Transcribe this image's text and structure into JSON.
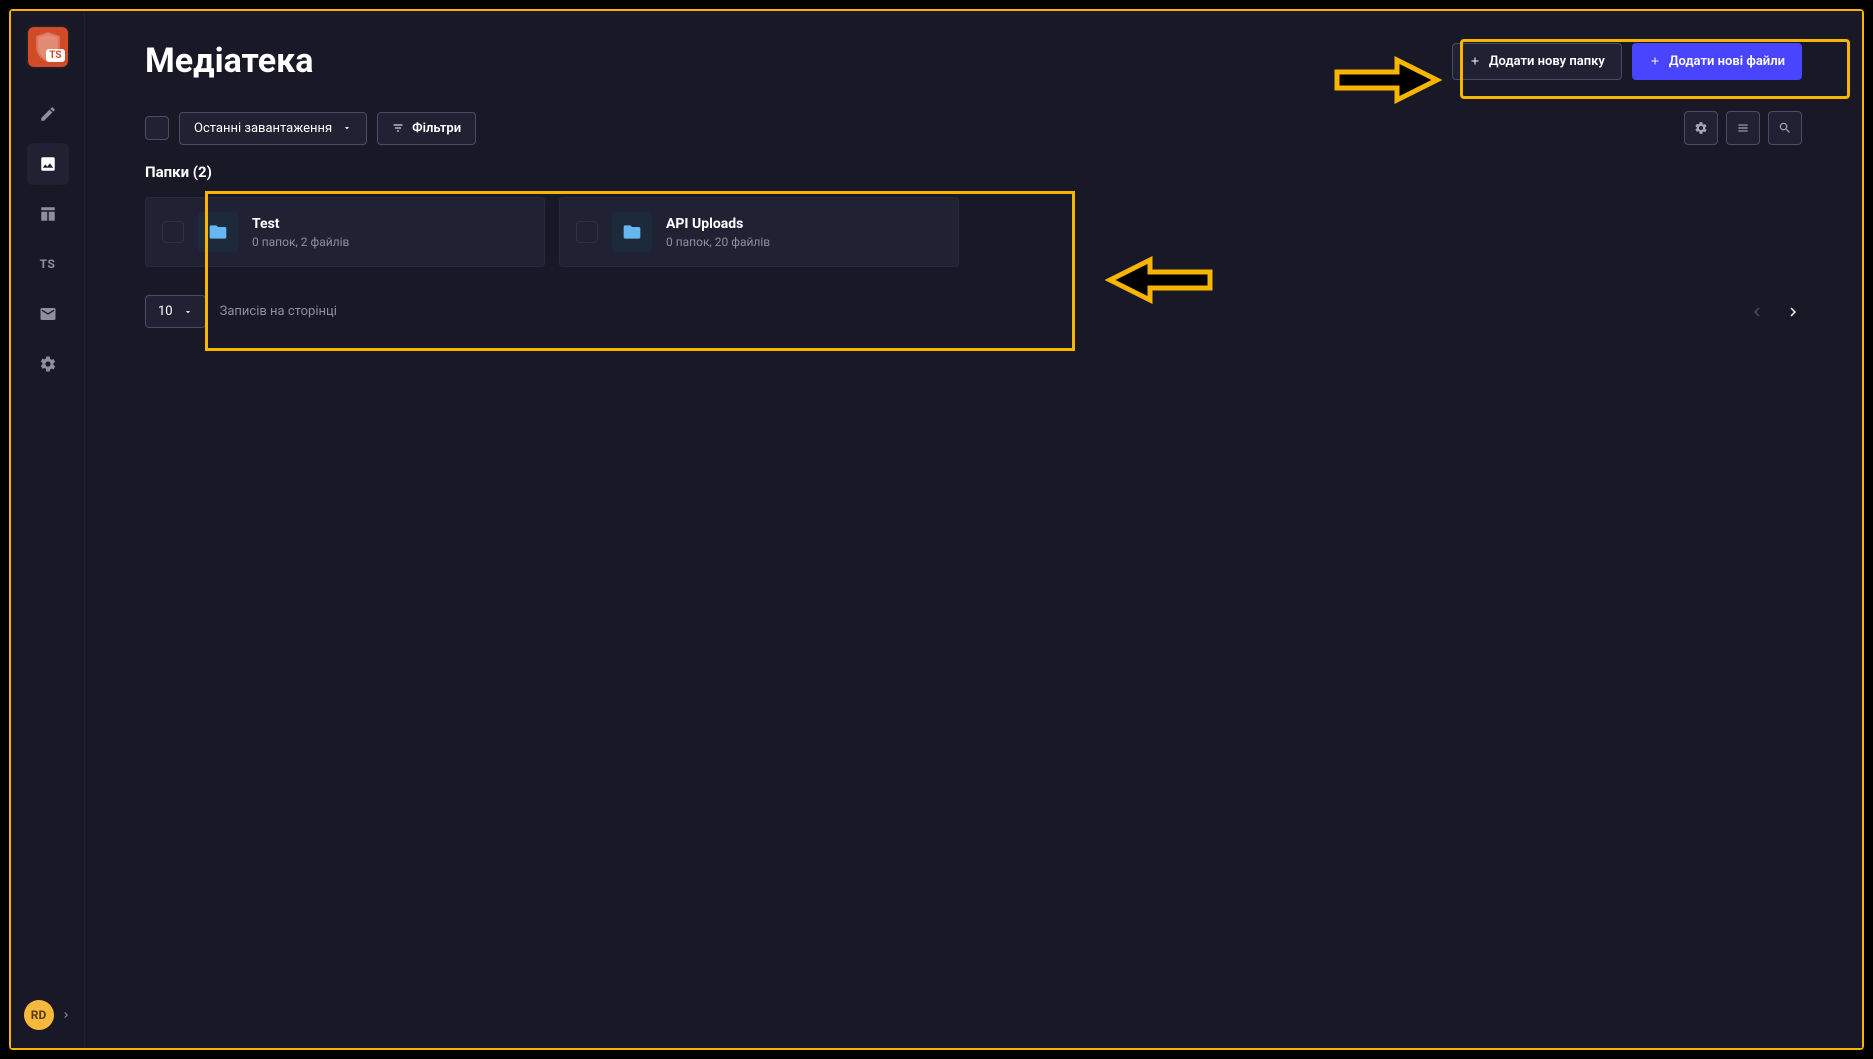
{
  "sidebar": {
    "logo_badge": "TS",
    "items": [
      {
        "name": "content-manager",
        "kind": "edit"
      },
      {
        "name": "media-library",
        "kind": "image",
        "active": true
      },
      {
        "name": "content-types",
        "kind": "layout"
      },
      {
        "name": "ts-plugin",
        "kind": "ts"
      },
      {
        "name": "email",
        "kind": "mail"
      },
      {
        "name": "settings",
        "kind": "gear"
      }
    ],
    "avatar_initials": "RD"
  },
  "header": {
    "title": "Медіатека",
    "add_folder_label": "Додати нову папку",
    "add_assets_label": "Додати нові файли"
  },
  "toolbar": {
    "sort_label": "Останні завантаження",
    "filter_label": "Фільтри"
  },
  "folders": {
    "section_title": "Папки (2)",
    "items": [
      {
        "name": "Test",
        "sub": "0 папок, 2 файлів"
      },
      {
        "name": "API Uploads",
        "sub": "0 папок, 20 файлів"
      }
    ]
  },
  "pagination": {
    "page_size": "10",
    "per_page_label": "Записів на сторінці"
  }
}
